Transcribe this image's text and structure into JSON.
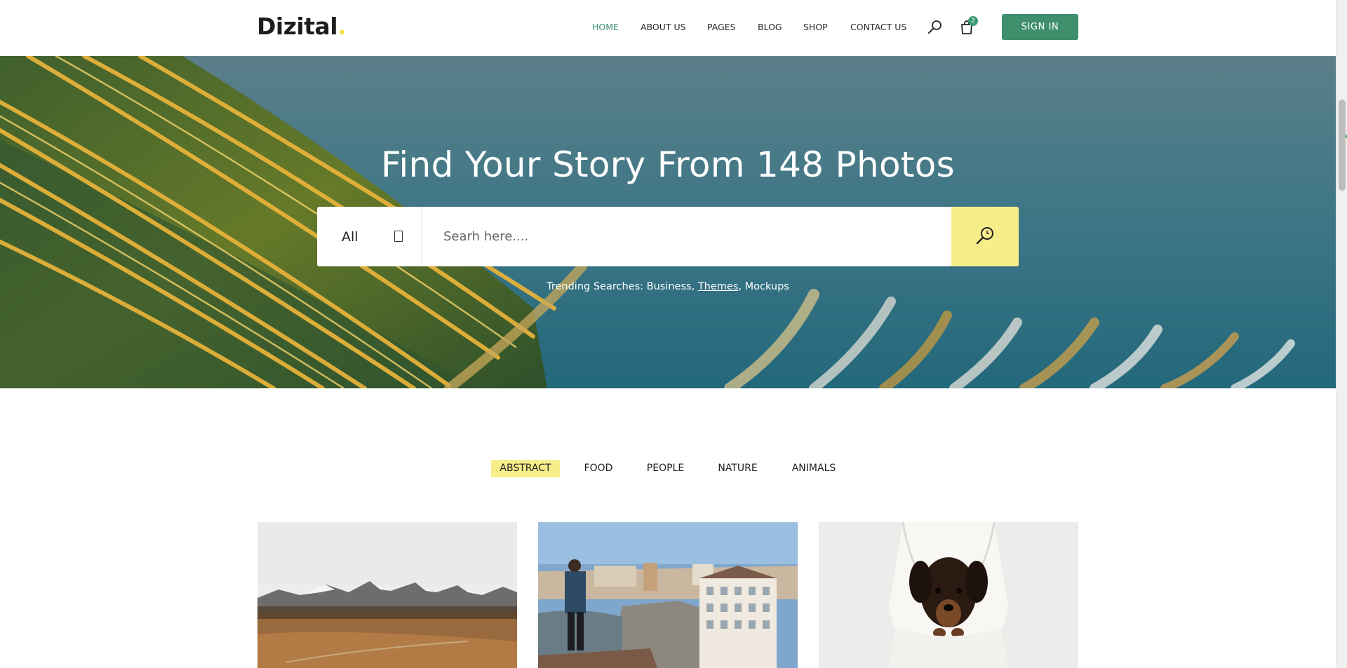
{
  "header": {
    "logo": "Dizital",
    "logo_dot": ".",
    "nav": [
      {
        "label": "HOME",
        "active": true
      },
      {
        "label": "ABOUT US",
        "active": false
      },
      {
        "label": "PAGES",
        "active": false
      },
      {
        "label": "BLOG",
        "active": false
      },
      {
        "label": "SHOP",
        "active": false
      },
      {
        "label": "CONTACT US",
        "active": false
      }
    ],
    "search_icon": "search-icon",
    "cart_icon": "shopping-bag-icon",
    "cart_count": "2",
    "signin_label": "SIGN IN"
  },
  "hero": {
    "title": "Find Your Story From 148 Photos",
    "category_selected": "All",
    "search_placeholder": "Searh here....",
    "search_button_icon": "search-icon",
    "trending_prefix": "Trending Searches:",
    "trending_links": [
      "Business",
      "Themes",
      "Mockups"
    ]
  },
  "filters": {
    "tabs": [
      {
        "label": "ABSTRACT",
        "active": true
      },
      {
        "label": "FOOD",
        "active": false
      },
      {
        "label": "PEOPLE",
        "active": false
      },
      {
        "label": "NATURE",
        "active": false
      },
      {
        "label": "ANIMALS",
        "active": false
      }
    ]
  },
  "gallery": {
    "items": [
      {
        "subject": "mountain-landscape-photo"
      },
      {
        "subject": "man-overlooking-city-photo"
      },
      {
        "subject": "dachshund-in-blanket-photo"
      }
    ]
  },
  "colors": {
    "accent_green": "#3f8f6d",
    "accent_yellow": "#f7ee8a",
    "nav_active": "#3b8f6a"
  }
}
